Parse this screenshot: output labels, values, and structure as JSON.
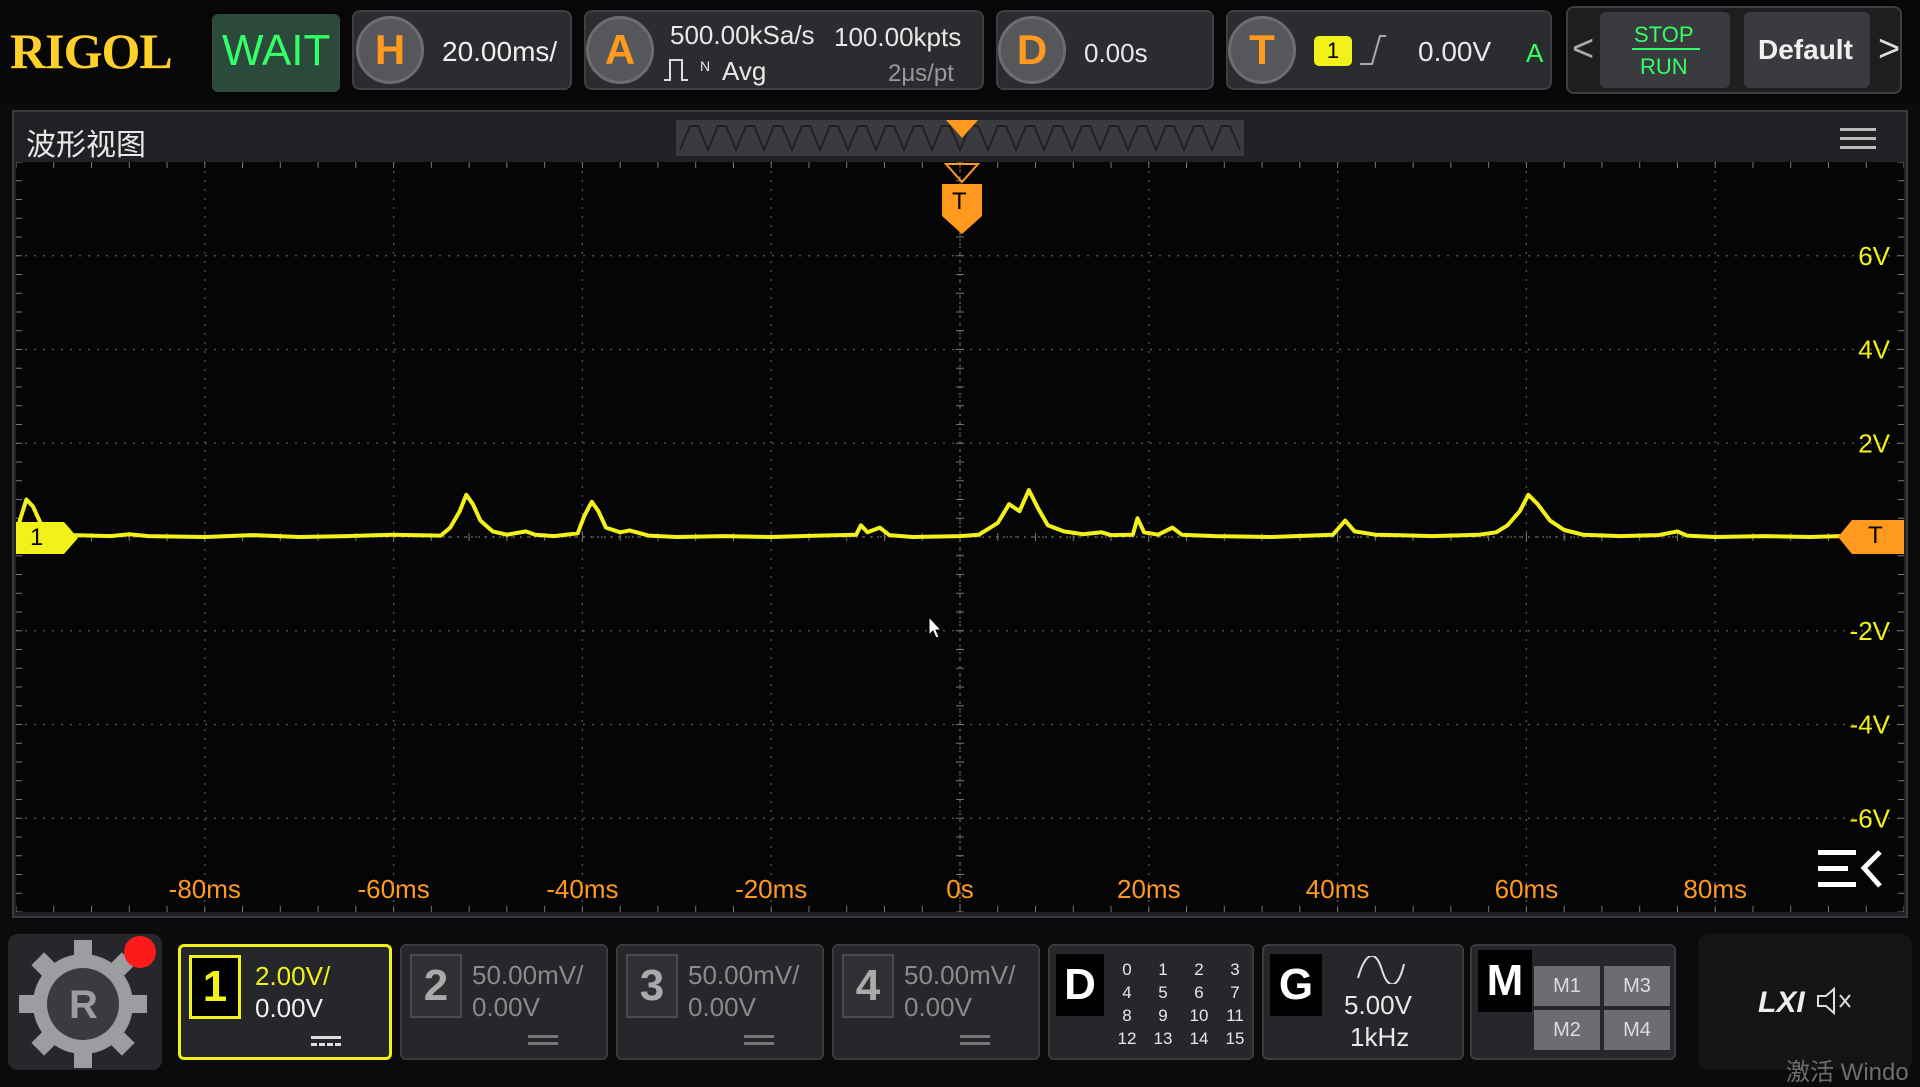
{
  "brand": "RIGOL",
  "status": "WAIT",
  "horizontal": {
    "badge": "H",
    "timebase": "20.00ms/"
  },
  "acquire": {
    "badge": "A",
    "sample_rate": "500.00kSa/s",
    "memory_depth": "100.00kpts",
    "mode_n": "N",
    "mode": "Avg",
    "time_per_pt": "2μs/pt"
  },
  "delay": {
    "badge": "D",
    "value": "0.00s"
  },
  "trigger": {
    "badge": "T",
    "source": "1",
    "level": "0.00V",
    "mode": "A"
  },
  "run": {
    "stop": "STOP",
    "run": "RUN"
  },
  "default_label": "Default",
  "window": {
    "title": "波形视图"
  },
  "wave": {
    "channel_marker": "1",
    "trigger_marker": "T",
    "trigger_top": "T",
    "y_ticks": [
      "6V",
      "4V",
      "2V",
      "-2V",
      "-4V",
      "-6V"
    ],
    "x_ticks": [
      "-80ms",
      "-60ms",
      "-40ms",
      "-20ms",
      "0s",
      "20ms",
      "40ms",
      "60ms",
      "80ms"
    ],
    "trace_color": "#f2f21a",
    "trigger_color": "#ff9a1e",
    "trace_points": [
      [
        -100,
        0.06
      ],
      [
        -99.6,
        0.35
      ],
      [
        -98.9,
        0.8
      ],
      [
        -98.2,
        0.65
      ],
      [
        -97.4,
        0.3
      ],
      [
        -96,
        0.12
      ],
      [
        -94,
        0.04
      ],
      [
        -90,
        0.02
      ],
      [
        -88,
        0.06
      ],
      [
        -86,
        0.02
      ],
      [
        -80,
        0.0
      ],
      [
        -75,
        0.04
      ],
      [
        -70,
        0.0
      ],
      [
        -65,
        0.02
      ],
      [
        -60,
        0.05
      ],
      [
        -55,
        0.03
      ],
      [
        -54,
        0.2
      ],
      [
        -53,
        0.55
      ],
      [
        -52.3,
        0.9
      ],
      [
        -51.6,
        0.7
      ],
      [
        -50.8,
        0.35
      ],
      [
        -49.5,
        0.12
      ],
      [
        -48,
        0.05
      ],
      [
        -46,
        0.12
      ],
      [
        -45,
        0.05
      ],
      [
        -43,
        0.02
      ],
      [
        -40.5,
        0.08
      ],
      [
        -39.8,
        0.45
      ],
      [
        -39,
        0.75
      ],
      [
        -38.3,
        0.55
      ],
      [
        -37.5,
        0.2
      ],
      [
        -36,
        0.1
      ],
      [
        -35,
        0.14
      ],
      [
        -33,
        0.03
      ],
      [
        -30,
        0.0
      ],
      [
        -25,
        0.02
      ],
      [
        -20,
        0.0
      ],
      [
        -15,
        0.03
      ],
      [
        -11,
        0.05
      ],
      [
        -10.5,
        0.25
      ],
      [
        -9.8,
        0.1
      ],
      [
        -8.5,
        0.2
      ],
      [
        -7.5,
        0.04
      ],
      [
        -5,
        0.0
      ],
      [
        0,
        0.02
      ],
      [
        2,
        0.05
      ],
      [
        4,
        0.3
      ],
      [
        5.2,
        0.7
      ],
      [
        6.3,
        0.55
      ],
      [
        7.3,
        1.0
      ],
      [
        8.3,
        0.6
      ],
      [
        9.3,
        0.25
      ],
      [
        11,
        0.12
      ],
      [
        13,
        0.06
      ],
      [
        15,
        0.1
      ],
      [
        16,
        0.04
      ],
      [
        18.3,
        0.05
      ],
      [
        18.8,
        0.4
      ],
      [
        19.5,
        0.1
      ],
      [
        21,
        0.05
      ],
      [
        22.5,
        0.2
      ],
      [
        23.5,
        0.05
      ],
      [
        27,
        0.02
      ],
      [
        33,
        0.0
      ],
      [
        39.5,
        0.05
      ],
      [
        40.8,
        0.35
      ],
      [
        41.8,
        0.12
      ],
      [
        44,
        0.05
      ],
      [
        46,
        0.04
      ],
      [
        50,
        0.02
      ],
      [
        55,
        0.05
      ],
      [
        56.8,
        0.1
      ],
      [
        58,
        0.25
      ],
      [
        59.3,
        0.55
      ],
      [
        60.2,
        0.9
      ],
      [
        61.2,
        0.7
      ],
      [
        62.5,
        0.35
      ],
      [
        64,
        0.15
      ],
      [
        66,
        0.05
      ],
      [
        70,
        0.02
      ],
      [
        74,
        0.04
      ],
      [
        76,
        0.12
      ],
      [
        77,
        0.03
      ],
      [
        80,
        0.0
      ],
      [
        85,
        0.02
      ],
      [
        90,
        0.0
      ],
      [
        95,
        0.03
      ],
      [
        100,
        0.0
      ]
    ]
  },
  "channels": [
    {
      "num": "1",
      "scale": "2.00V/",
      "offset": "0.00V"
    },
    {
      "num": "2",
      "scale": "50.00mV/",
      "offset": "0.00V"
    },
    {
      "num": "3",
      "scale": "50.00mV/",
      "offset": "0.00V"
    },
    {
      "num": "4",
      "scale": "50.00mV/",
      "offset": "0.00V"
    }
  ],
  "digital": {
    "badge": "D",
    "bits": [
      "0",
      "1",
      "2",
      "3",
      "4",
      "5",
      "6",
      "7",
      "8",
      "9",
      "10",
      "11",
      "12",
      "13",
      "14",
      "15"
    ]
  },
  "generator": {
    "badge": "G",
    "amplitude": "5.00V",
    "frequency": "1kHz"
  },
  "math": {
    "badge": "M",
    "m1": "M1",
    "m2": "M2",
    "m3": "M3",
    "m4": "M4"
  },
  "lxi": "LXI",
  "watermark": "激活 Windo"
}
